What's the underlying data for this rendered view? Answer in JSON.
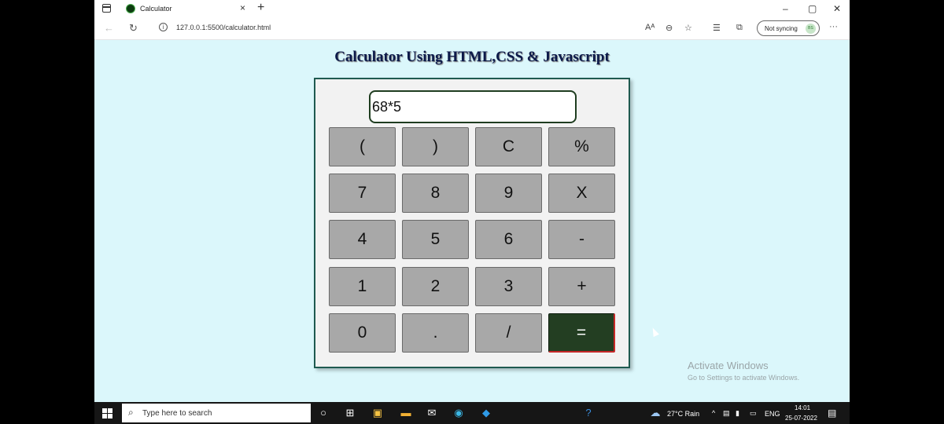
{
  "browser": {
    "tab_title": "Calculator",
    "tab_close": "×",
    "new_tab": "+",
    "url": "127.0.0.1:5500/calculator.html",
    "sync_label": "Not syncing",
    "sync_avatar": "BS",
    "window_buttons": [
      "–",
      "▢",
      "✕"
    ]
  },
  "page": {
    "title": "Calculator Using HTML,CSS & Javascript"
  },
  "calculator": {
    "display_value": "68*5",
    "keys": [
      [
        "(",
        ")",
        "C",
        "%"
      ],
      [
        "7",
        "8",
        "9",
        "X"
      ],
      [
        "4",
        "5",
        "6",
        "-"
      ],
      [
        "1",
        "2",
        "3",
        "+"
      ],
      [
        "0",
        ".",
        "/",
        "="
      ]
    ],
    "equals_color": "#233e22",
    "key_color": "#a8a8a8"
  },
  "watermark": {
    "title": "Activate Windows",
    "subtitle": "Go to Settings to activate Windows."
  },
  "taskbar": {
    "search_placeholder": "Type here to search",
    "weather": "27°C  Rain",
    "language": "ENG",
    "time": "14:01",
    "date": "25-07-2022"
  }
}
